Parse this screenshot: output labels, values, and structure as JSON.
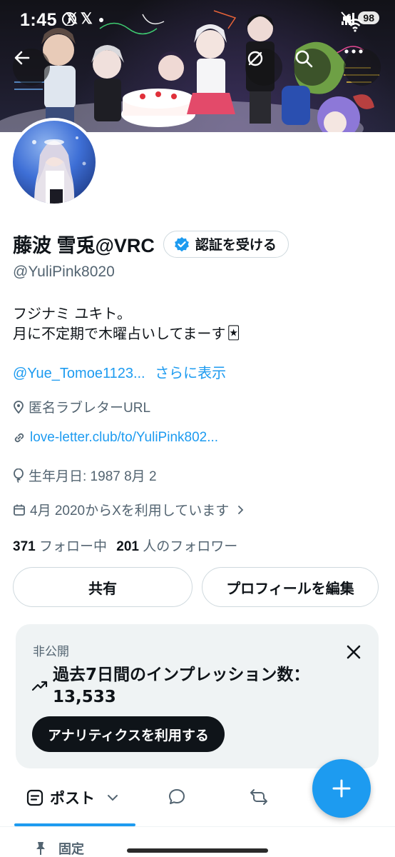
{
  "status_bar": {
    "time": "1:45",
    "left_icons": [
      "x-logo-icon",
      "x-logo-icon",
      "info-icon",
      "dot-icon"
    ],
    "right_icons": [
      "mute-icon",
      "wifi-icon",
      "signal-icon"
    ],
    "network_badge": "6",
    "battery": "98"
  },
  "header": {
    "banner_desc": "VRChat avatar group photo banner",
    "back_icon": "back-arrow-icon",
    "actions": [
      "refresh-icon",
      "search-icon",
      "more-icon"
    ]
  },
  "profile": {
    "display_name": "藤波 雪兎@VRC",
    "verify_label": "認証を受ける",
    "handle": "@YuliPink8020",
    "bio_lines": [
      "フジナミ ユキト。",
      "月に不定期で木曜占いしてまーす"
    ],
    "bio_emoji": "🃏",
    "mention": "@Yue_Tomoe1123...",
    "show_more": "さらに表示",
    "location": "匿名ラブレターURL",
    "website": "love-letter.club/to/YuliPink802...",
    "birthday": "生年月日: 1987 8月 2",
    "joined": "4月 2020からXを利用しています",
    "following_count": "371",
    "following_label": "フォロー中",
    "followers_count": "201",
    "followers_label": "人のフォロワー"
  },
  "buttons": {
    "share": "共有",
    "edit_profile": "プロフィールを編集"
  },
  "analytics_card": {
    "private_label": "非公開",
    "title": "過去7日間のインプレッション数：",
    "value": "13,533",
    "cta": "アナリティクスを利用する"
  },
  "tabs": {
    "active_label": "ポスト",
    "items": [
      "posts-icon",
      "reply-icon",
      "repost-icon"
    ]
  },
  "pinned_label": "固定",
  "colors": {
    "accent": "#1d9bf0",
    "text": "#0f1419",
    "muted": "#536471",
    "card_bg": "#eff3f4"
  }
}
